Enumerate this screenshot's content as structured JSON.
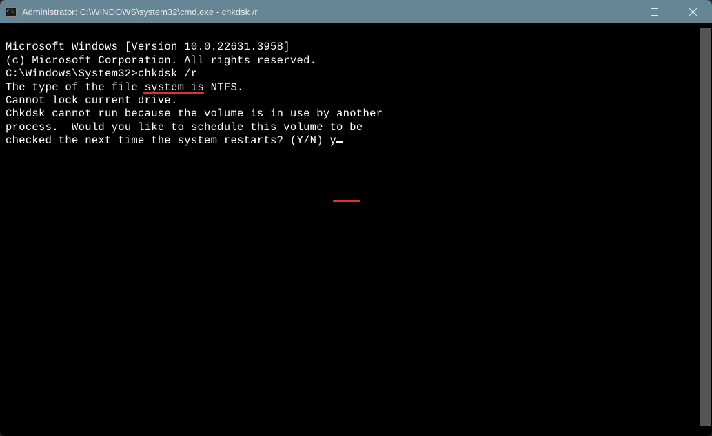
{
  "titlebar": {
    "icon_label": "C:\\",
    "title": "Administrator: C:\\WINDOWS\\system32\\cmd.exe - chkdsk  /r"
  },
  "terminal": {
    "line1": "Microsoft Windows [Version 10.0.22631.3958]",
    "line2": "(c) Microsoft Corporation. All rights reserved.",
    "blank1": "",
    "prompt": "C:\\Windows\\System32>",
    "command": "chkdsk /r",
    "line4": "The type of the file system is NTFS.",
    "line5": "Cannot lock current drive.",
    "blank2": "",
    "line6": "Chkdsk cannot run because the volume is in use by another",
    "line7": "process.  Would you like to schedule this volume to be",
    "line8_pre": "checked the next time the system restarts? (Y/N) ",
    "line8_input": "y"
  },
  "controls": {
    "minimize": "minimize",
    "maximize": "maximize",
    "close": "close"
  }
}
